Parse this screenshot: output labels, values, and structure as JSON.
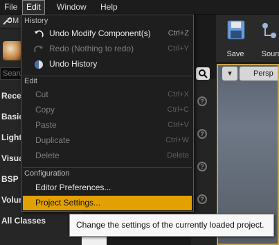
{
  "menubar": {
    "items": [
      "File",
      "Edit",
      "Window",
      "Help"
    ]
  },
  "left_panel": {
    "tab_label": "M",
    "search_placeholder": "Searc",
    "categories": [
      "Rece",
      "Basic",
      "Light",
      "Visua",
      "BSP",
      "Volur",
      "All Classes"
    ]
  },
  "toolbar": {
    "save_label": "Save",
    "source_label": "Sourc"
  },
  "viewport": {
    "perspective_label": "Persp"
  },
  "edit_menu": {
    "history_header": "History",
    "undo_label": "Undo Modify Component(s)",
    "undo_shortcut": "Ctrl+Z",
    "redo_label": "Redo (Nothing to redo)",
    "redo_shortcut": "Ctrl+Y",
    "undo_history_label": "Undo History",
    "edit_header": "Edit",
    "cut_label": "Cut",
    "cut_shortcut": "Ctrl+X",
    "copy_label": "Copy",
    "copy_shortcut": "Ctrl+C",
    "paste_label": "Paste",
    "paste_shortcut": "Ctrl+V",
    "duplicate_label": "Duplicate",
    "duplicate_shortcut": "Ctrl+W",
    "delete_label": "Delete",
    "delete_shortcut": "Delete",
    "configuration_header": "Configuration",
    "editor_prefs_label": "Editor Preferences...",
    "project_settings_label": "Project Settings..."
  },
  "tooltip": {
    "text": "Change the settings of the currently loaded project."
  },
  "colors": {
    "highlight": "#e2a100",
    "menu_bg": "#1e1e1e"
  }
}
